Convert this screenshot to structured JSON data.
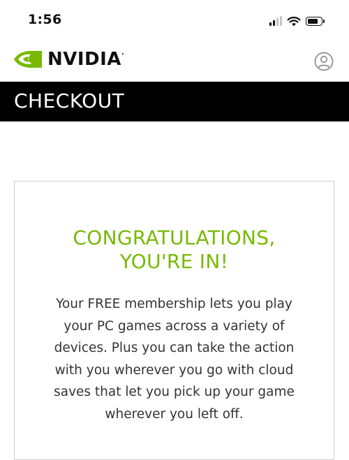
{
  "status_bar": {
    "time": "1:56"
  },
  "header": {
    "brand": "NVIDIA",
    "brand_mark": "."
  },
  "checkout": {
    "title": "CHECKOUT"
  },
  "card": {
    "heading_line1": "CONGRATULATIONS,",
    "heading_line2": "YOU'RE IN!",
    "body": "Your FREE membership lets you play your PC games across a variety of devices. Plus you can take the action with you wherever you go with cloud saves that let you pick up your game wherever you left off."
  },
  "colors": {
    "accent": "#76b900",
    "bar": "#000000"
  },
  "icons": [
    "signal-icon",
    "wifi-icon",
    "battery-icon",
    "nvidia-eye-logo-icon",
    "account-icon"
  ]
}
